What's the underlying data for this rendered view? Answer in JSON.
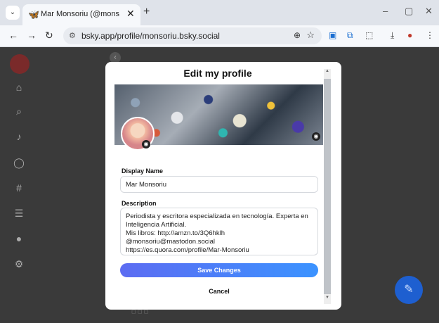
{
  "browser": {
    "tab_title": "Mar Monsoriu (@monsoriu.bsky.social)",
    "tab_close": "✕",
    "new_tab": "+",
    "url": "bsky.app/profile/monsoriu.bsky.social",
    "window": {
      "minimize": "–",
      "maximize": "▢",
      "close": "✕"
    }
  },
  "modal": {
    "title": "Edit my profile",
    "display_name_label": "Display Name",
    "display_name_value": "Mar Monsoriu",
    "description_label": "Description",
    "description_value": "Periodista y escritora especializada en tecnología. Experta en Inteligencia Artificial.\nMis libros: http://amzn.to/3Q6hklh\n@monsoriu@mastodon.social\nhttps://es.quora.com/profile/Mar-Monsoriu",
    "save_label": "Save Changes",
    "cancel_label": "Cancel"
  },
  "colors": {
    "save_gradient_start": "#5c6cf2",
    "save_gradient_end": "#3b93ff",
    "backdrop": "#3a3a3a",
    "brand": "#1185fe"
  },
  "icons": [
    "bluesky-butterfly-icon",
    "back-arrow-icon",
    "forward-arrow-icon",
    "reload-icon",
    "site-settings-icon",
    "zoom-icon",
    "star-icon",
    "download-icon",
    "menu-kebab-icon",
    "home-icon",
    "search-icon",
    "bell-icon",
    "chat-icon",
    "hashtag-icon",
    "list-icon",
    "profile-icon",
    "settings-icon",
    "camera-icon",
    "compose-icon"
  ]
}
